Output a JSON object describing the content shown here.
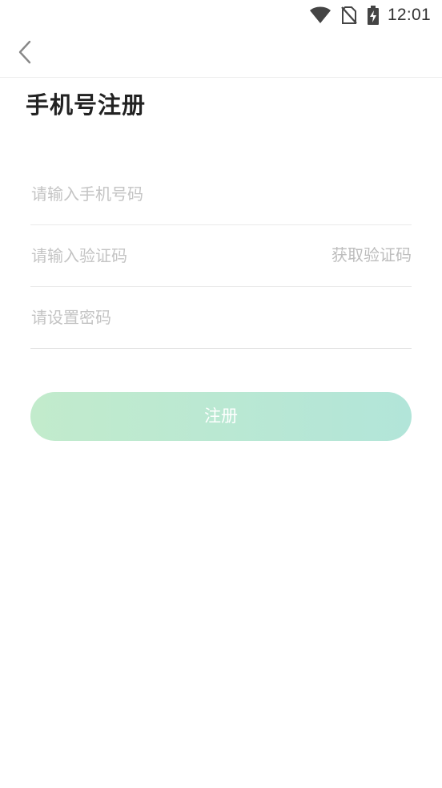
{
  "status_bar": {
    "time": "12:01",
    "icons": [
      "wifi-icon",
      "no-sim-icon",
      "battery-charging-icon"
    ]
  },
  "toolbar": {
    "back_icon": "chevron-left-icon"
  },
  "page": {
    "title": "手机号注册"
  },
  "form": {
    "phone_placeholder": "请输入手机号码",
    "phone_value": "",
    "code_placeholder": "请输入验证码",
    "code_value": "",
    "get_code_label": "获取验证码",
    "password_placeholder": "请设置密码",
    "password_value": ""
  },
  "register_button": {
    "label": "注册",
    "gradient_start": "#c2ebcc",
    "gradient_end": "#b2e5d9",
    "enabled": false
  },
  "colors": {
    "background": "#ffffff",
    "title": "#222222",
    "placeholder": "#c4c4c4",
    "divider": "#e9e9e9"
  }
}
